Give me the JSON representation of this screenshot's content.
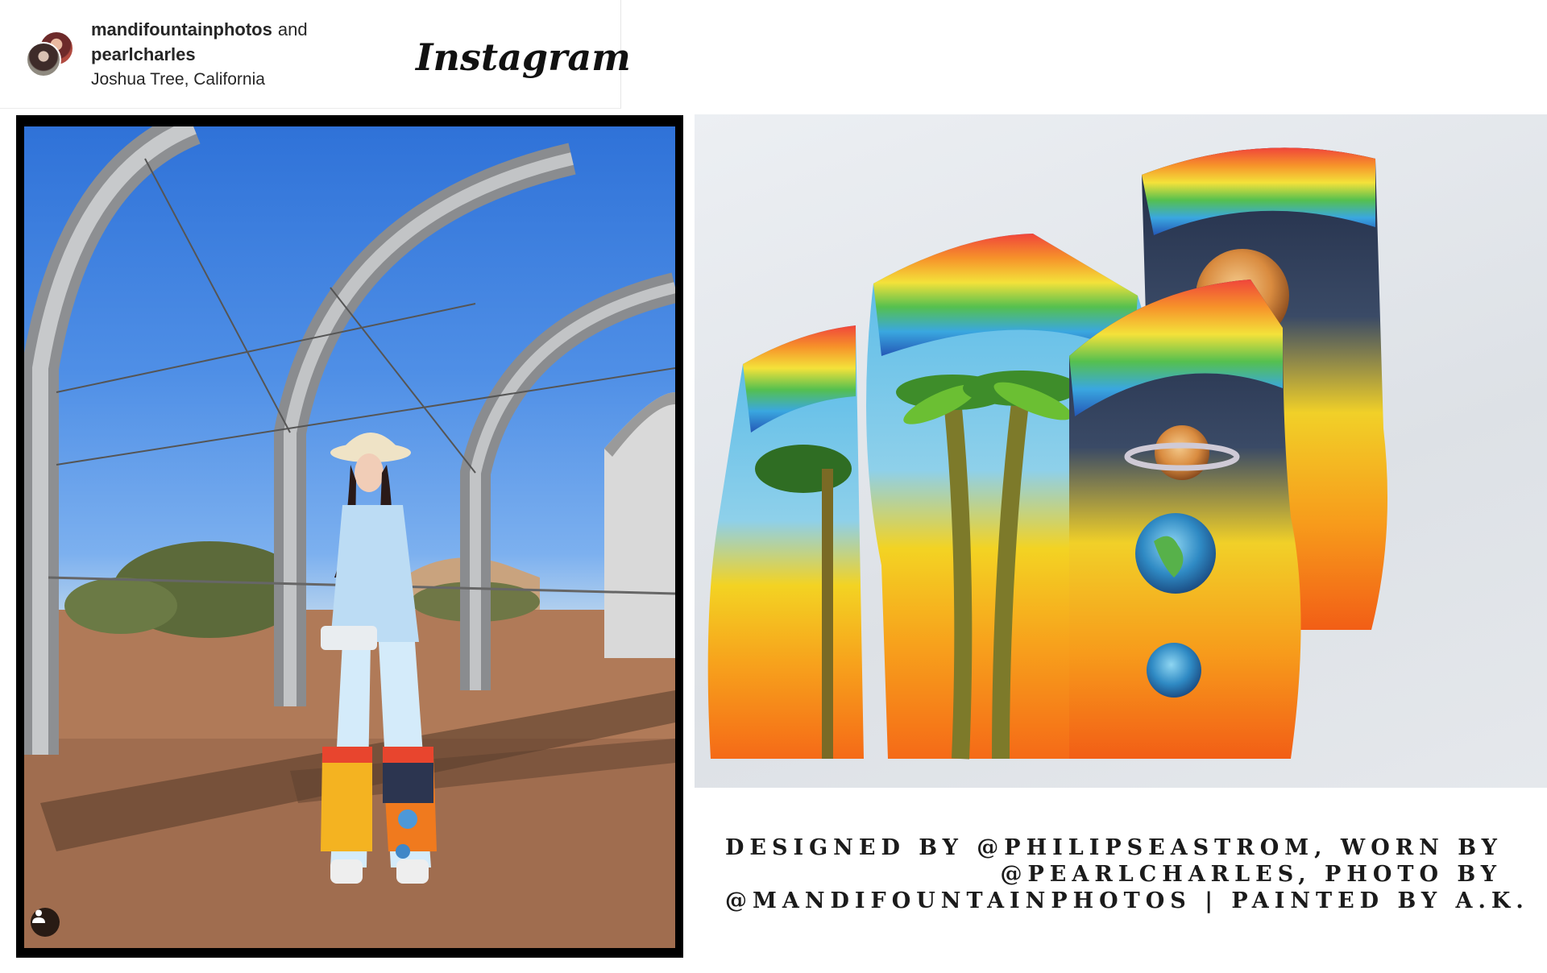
{
  "post": {
    "account_primary": "mandifountainphotos",
    "joiner": "and",
    "account_secondary": "pearlcharles",
    "location": "Joshua Tree, California",
    "platform_logo": "Instagram",
    "tag_icon": "user-tag-icon"
  },
  "caption": {
    "line1": "DESIGNED BY @PHILIPSEASTROM, WORN BY",
    "line2": "@PEARLCHARLES, PHOTO BY",
    "line3": "@MANDIFOUNTAINPHOTOS | PAINTED BY A.K."
  },
  "colors": {
    "sky": "#4f8fe6",
    "rainbow_red": "#f04b3b",
    "sunset_orange": "#f7941d",
    "night_navy": "#24304a"
  }
}
